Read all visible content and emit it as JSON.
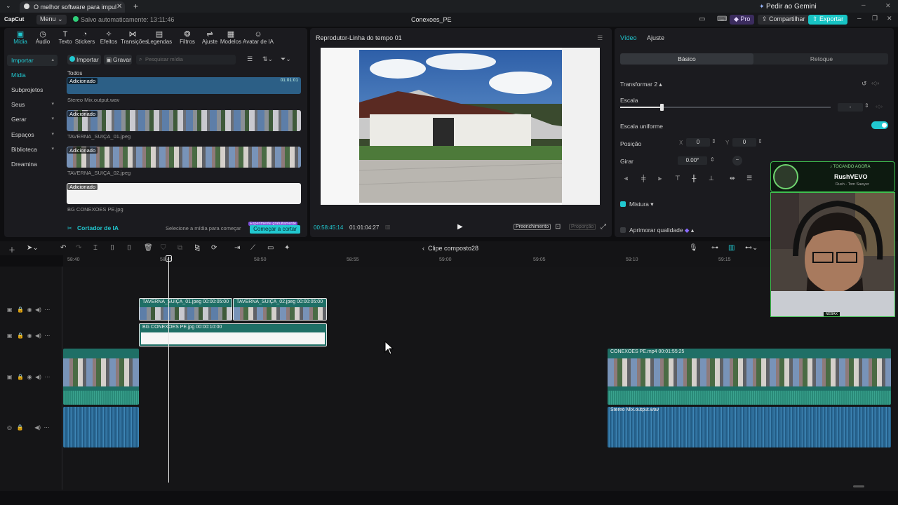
{
  "browser": {
    "tab_title": "O melhor software para impul",
    "gemini": "Pedir ao Gemini"
  },
  "app": {
    "logo": "CapCut",
    "menu": "Menu",
    "autosave": "Salvo automaticamente: 13:11:46",
    "doc_title": "Conexoes_PE",
    "pro": "Pro",
    "share": "Compartilhar",
    "export": "Exportar"
  },
  "toolbar": [
    {
      "label": "Mídia",
      "icon": "media-icon",
      "active": true
    },
    {
      "label": "Áudio",
      "icon": "audio-icon"
    },
    {
      "label": "Texto",
      "icon": "text-icon"
    },
    {
      "label": "Stickers",
      "icon": "sticker-icon"
    },
    {
      "label": "Efeitos",
      "icon": "effects-icon"
    },
    {
      "label": "Transições",
      "icon": "transitions-icon"
    },
    {
      "label": "Legendas",
      "icon": "captions-icon"
    },
    {
      "label": "Filtros",
      "icon": "filters-icon"
    },
    {
      "label": "Ajuste",
      "icon": "adjust-icon"
    },
    {
      "label": "Modelos",
      "icon": "templates-icon"
    },
    {
      "label": "Avatar de IA",
      "icon": "ai-avatar-icon"
    }
  ],
  "nav": [
    {
      "label": "Importar",
      "selected": true
    },
    {
      "label": "Mídia"
    },
    {
      "label": "Subprojetos"
    },
    {
      "label": "Seus"
    },
    {
      "label": "Gerar"
    },
    {
      "label": "Espaços"
    },
    {
      "label": "Biblioteca"
    },
    {
      "label": "Dreamina"
    }
  ],
  "media": {
    "import_btn": "Importar",
    "record_btn": "Gravar",
    "search_placeholder": "Pesquisar mídia",
    "filter_label": "Todos",
    "items": [
      {
        "tag": "Adicionado",
        "name": "Stereo Mix.output.wav",
        "duration": "01:01:01"
      },
      {
        "tag": "Adicionado",
        "name": "TAVERNA_SUIÇA_01.jpeg"
      },
      {
        "tag": "Adicionado",
        "name": "TAVERNA_SUIÇA_02.jpeg"
      },
      {
        "tag": "Adicionado",
        "name": "BG CONEXOES PE.jpg"
      }
    ],
    "cutter_label": "Cortador de IA",
    "cutter_hint": "Selecione a mídia para começar",
    "cutter_badge": "Experimente gratuitamente",
    "cutter_btn": "Começar a cortar"
  },
  "player": {
    "title": "Reprodutor-Linha do tempo 01",
    "current_time": "00:58:45:14",
    "total_time": "01:01:04:27",
    "fill_btn": "Preenchimento",
    "ratio_btn": "Proporção"
  },
  "inspector": {
    "tab_video": "Vídeo",
    "tab_adjust": "Ajuste",
    "seg_basic": "Básico",
    "seg_retouch": "Retoque",
    "transform": "Transformar 2",
    "scale": "Escala",
    "scale_value": "-",
    "uniform_scale": "Escala uniforme",
    "position": "Posição",
    "pos_x_label": "X",
    "pos_x": "0",
    "pos_y_label": "Y",
    "pos_y": "0",
    "rotate": "Girar",
    "rotate_value": "0.00°",
    "rotate_dial": "–",
    "blend": "Mistura",
    "enhance": "Aprimorar qualidade"
  },
  "timeline": {
    "compound_clip": "Clipe composto28",
    "ruler": [
      "58:40",
      "58:45",
      "58:50",
      "58:55",
      "59:00",
      "59:05",
      "59:10",
      "59:15"
    ],
    "clips": {
      "taverna1": "TAVERNA_SUIÇA_01.jpeg   00:00:05:00",
      "taverna2": "TAVERNA_SUIÇA_02.jpeg   00:00:05:00",
      "bg": "BG CONEXOES PE.jpg   00:00:10:00",
      "main_video": "CONEXOES PE.mp4   00:01:55:25",
      "audio": "Stereo Mix.output.wav"
    }
  },
  "overlay": {
    "now_playing": "♪ TOCANDO AGORA",
    "artist": "RushVEVO",
    "song": "Rush - Tom Sawyer",
    "webcam_tag": "NEBAX"
  },
  "colors": {
    "accent": "#21c8d0",
    "panel": "#1b1b1f",
    "clip_teal": "#1f6f66",
    "audio_blue": "#2d6d9a"
  }
}
